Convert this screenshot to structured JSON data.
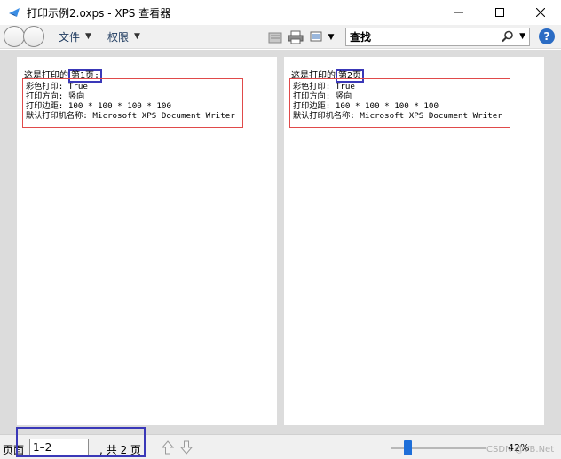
{
  "window": {
    "title": "打印示例2.oxps - XPS 查看器"
  },
  "toolbar": {
    "menu_file": "文件",
    "menu_permissions": "权限",
    "search_value": "查找"
  },
  "pages": [
    {
      "header_prefix": "这是打印的",
      "page_label": "第1页:",
      "lines": [
        "彩色打印: True",
        "打印方向: 竖向",
        "打印边距: 100 * 100 * 100 * 100",
        "默认打印机名称: Microsoft XPS Document Writer"
      ]
    },
    {
      "header_prefix": "这是打印的",
      "page_label": "第2页",
      "lines": [
        "彩色打印: True",
        "打印方向: 竖向",
        "打印边距: 100 * 100 * 100 * 100",
        "默认打印机名称: Microsoft XPS Document Writer"
      ]
    }
  ],
  "status": {
    "page_label": "页面",
    "page_value": "1–2",
    "total_text": ", 共 2 页",
    "zoom": "42%"
  },
  "watermark": "CSDN @VB.Net",
  "colors": {
    "highlight_blue": "#3a38b8",
    "info_red": "#e04a4a",
    "zoom_thumb": "#1e6fd9",
    "help_blue": "#2b6cc4"
  },
  "icons": [
    "app-icon",
    "minimize-icon",
    "maximize-icon",
    "close-icon",
    "back-forward-icon",
    "folder-icon",
    "print-icon",
    "view-options-icon",
    "search-icon",
    "help-icon",
    "arrow-up-icon",
    "arrow-down-icon"
  ]
}
